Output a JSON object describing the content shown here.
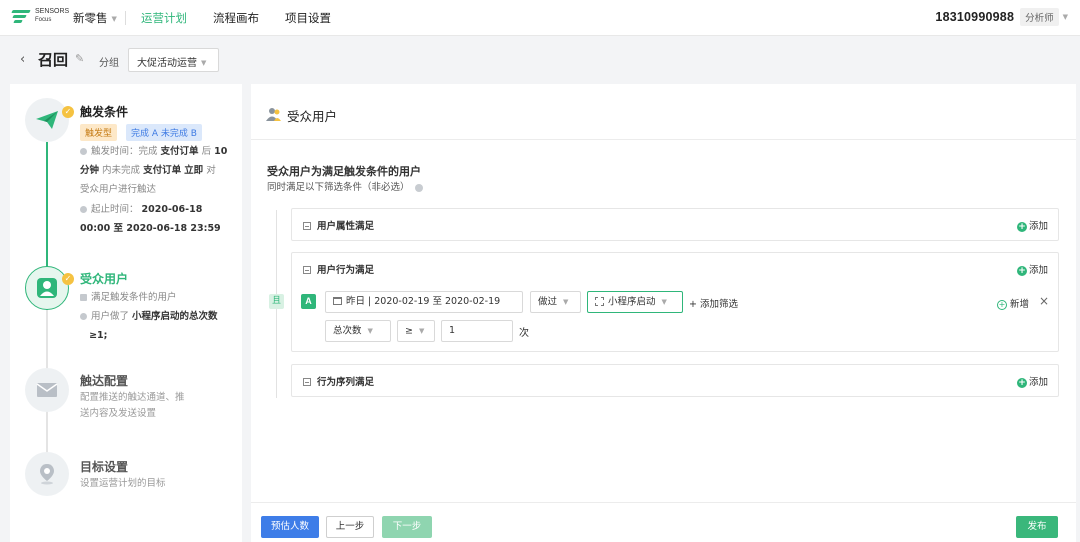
{
  "nav": {
    "logo_top": "SENSORS",
    "logo_bottom": "Focus",
    "project": "新零售",
    "items": [
      "运营计划",
      "流程画布",
      "项目设置"
    ],
    "user_phone": "18310990988",
    "user_role": "分析师"
  },
  "title_bar": {
    "title": "召回",
    "group_label": "分组",
    "group_value": "大促活动运营"
  },
  "steps": {
    "trigger": {
      "title": "触发条件",
      "tag_type": "触发型",
      "tag_rule": "完成 A 未完成 B",
      "time_prefix": "触发时间：完成",
      "time_event_a": "支付订单",
      "time_after": "后",
      "time_amount": "10",
      "time_unit": "分钟",
      "time_mid": "内未完成",
      "time_event_b": "支付订单",
      "time_immediate": "立即",
      "time_suffix": "对",
      "time_line3": "受众用户进行触达",
      "period_label": "起止时间：",
      "period_start_date": "2020-06-18",
      "period_start_time": "00:00 至 2020-06-18 23:59"
    },
    "audience": {
      "title": "受众用户",
      "desc1": "满足触发条件的用户",
      "desc2_prefix": "用户做了",
      "desc2_value": "小程序启动的总次数",
      "desc2_line2": "≥1;"
    },
    "reach": {
      "title": "触达配置",
      "desc_line1": "配置推送的触达通道、推",
      "desc_line2": "送内容及发送设置"
    },
    "goal": {
      "title": "目标设置",
      "desc": "设置运营计划的目标"
    }
  },
  "panel": {
    "title": "受众用户",
    "section_title": "受众用户为满足触发条件的用户",
    "section_sub": "同时满足以下筛选条件（非必选）",
    "add_label": "添加",
    "boxes": {
      "attr": "用户属性满足",
      "behavior": "用户行为满足",
      "sequence": "行为序列满足"
    },
    "and_tag": "且",
    "rule": {
      "label": "A",
      "date_range": "昨日 | 2020-02-19 至 2020-02-19",
      "action": "做过",
      "event": "小程序启动",
      "add_filter": "+ 添加筛选",
      "add_new": "新增",
      "close": "×",
      "metric": "总次数",
      "operator": "≥",
      "value": "1",
      "unit": "次"
    }
  },
  "footer": {
    "estimate": "预估人数",
    "prev": "上一步",
    "next": "下一步",
    "publish": "发布"
  }
}
